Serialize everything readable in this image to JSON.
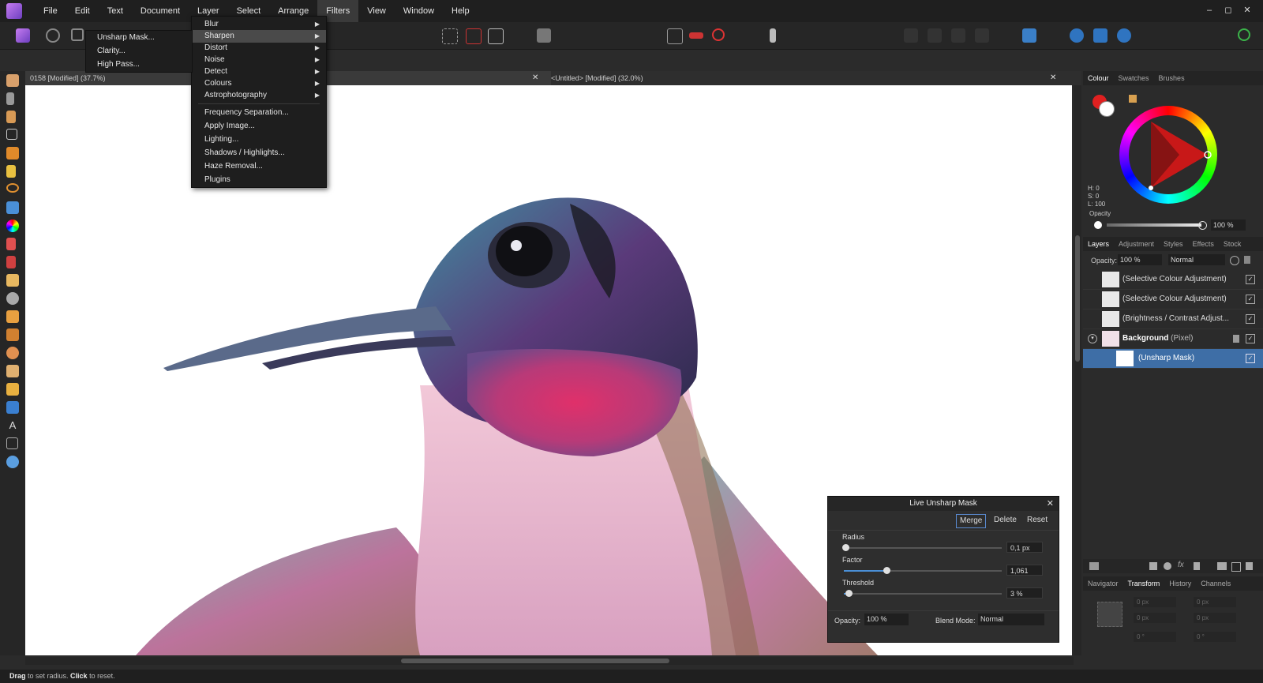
{
  "menubar": {
    "items": [
      "File",
      "Edit",
      "Text",
      "Document",
      "Layer",
      "Select",
      "Arrange",
      "Filters",
      "View",
      "Window",
      "Help"
    ],
    "active": "Filters"
  },
  "window_controls": [
    "–",
    "◻",
    "✕"
  ],
  "filters_menu": {
    "items": [
      {
        "label": "Blur",
        "submenu": true
      },
      {
        "label": "Sharpen",
        "submenu": true
      },
      {
        "label": "Distort",
        "submenu": true
      },
      {
        "label": "Noise",
        "submenu": true
      },
      {
        "label": "Detect",
        "submenu": true
      },
      {
        "label": "Colours",
        "submenu": true
      },
      {
        "label": "Astrophotography",
        "submenu": true
      },
      {
        "label": "Frequency Separation...",
        "submenu": false
      },
      {
        "label": "Apply Image...",
        "submenu": false
      },
      {
        "label": "Lighting...",
        "submenu": false
      },
      {
        "label": "Shadows / Highlights...",
        "submenu": false
      },
      {
        "label": "Haze Removal...",
        "submenu": false
      },
      {
        "label": "Plugins",
        "submenu": false
      }
    ],
    "highlighted": "Sharpen"
  },
  "sharpen_submenu": [
    "Unsharp Mask...",
    "Clarity...",
    "High Pass..."
  ],
  "doc_tabs": [
    {
      "title": "0158 [Modified] (37.7%)"
    },
    {
      "title": "<Untitled> [Modified] (32.0%)"
    }
  ],
  "colour_panel": {
    "tabs": [
      "Colour",
      "Swatches",
      "Brushes"
    ],
    "active_tab": "Colour",
    "hsl": {
      "h": "H: 0",
      "s": "S: 0",
      "l": "L: 100"
    },
    "opacity_label": "Opacity",
    "opacity_value": "100 %",
    "primary_color": "#e02020",
    "secondary_color": "#ffffff"
  },
  "layers_panel": {
    "tabs": [
      "Layers",
      "Adjustment",
      "Styles",
      "Effects",
      "Stock"
    ],
    "active_tab": "Layers",
    "opacity_label": "Opacity:",
    "opacity_value": "100 %",
    "blend_mode": "Normal",
    "layers": [
      {
        "name": "(Selective Colour Adjustment)",
        "checked": true
      },
      {
        "name": "(Selective Colour Adjustment)",
        "checked": true
      },
      {
        "name": "(Brightness / Contrast Adjust...",
        "checked": true
      },
      {
        "name": "Background",
        "type": "(Pixel)",
        "checked": true
      },
      {
        "name": "(Unsharp Mask)",
        "checked": true,
        "selected": true
      }
    ]
  },
  "bottom_tabs": {
    "tabs": [
      "Navigator",
      "Transform",
      "History",
      "Channels"
    ],
    "active_tab": "Transform",
    "fields": [
      "0 px",
      "0 px",
      "0 px",
      "0 px",
      "0 °",
      "0 °"
    ]
  },
  "live_dialog": {
    "title": "Live Unsharp Mask",
    "buttons": [
      "Merge",
      "Delete",
      "Reset"
    ],
    "radius_label": "Radius",
    "radius_value": "0,1 px",
    "radius_level": 0.01,
    "factor_label": "Factor",
    "factor_value": "1,061",
    "factor_level": 0.27,
    "threshold_label": "Threshold",
    "threshold_value": "3 %",
    "threshold_level": 0.03,
    "opacity_label": "Opacity:",
    "opacity_value": "100 %",
    "blend_label": "Blend Mode:",
    "blend_value": "Normal"
  },
  "status": {
    "drag": "Drag",
    "drag_text": " to set radius. ",
    "click": "Click",
    "click_text": " to reset."
  },
  "accent_color": "#4a8fd6"
}
